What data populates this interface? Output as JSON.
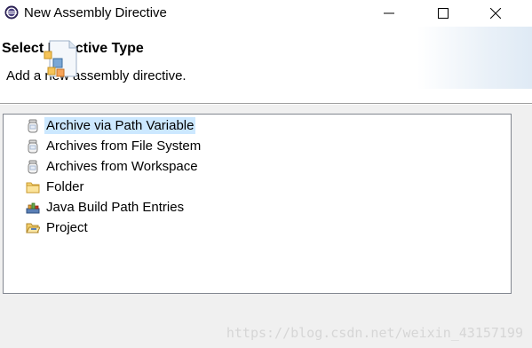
{
  "window": {
    "title": "New Assembly Directive"
  },
  "header": {
    "title": "Select Directive Type",
    "description": "Add a new assembly directive."
  },
  "list": {
    "items": [
      {
        "label": "Archive via Path Variable",
        "icon": "jar-icon",
        "selected": true
      },
      {
        "label": "Archives from File System",
        "icon": "jar-icon",
        "selected": false
      },
      {
        "label": "Archives from Workspace",
        "icon": "jar-icon",
        "selected": false
      },
      {
        "label": "Folder",
        "icon": "folder-icon",
        "selected": false
      },
      {
        "label": "Java Build Path Entries",
        "icon": "library-icon",
        "selected": false
      },
      {
        "label": "Project",
        "icon": "open-folder-icon",
        "selected": false
      }
    ]
  },
  "watermark": "https://blog.csdn.net/weixin_43157199",
  "colors": {
    "selection": "#cce8ff",
    "banner": "#dfeaf5"
  }
}
